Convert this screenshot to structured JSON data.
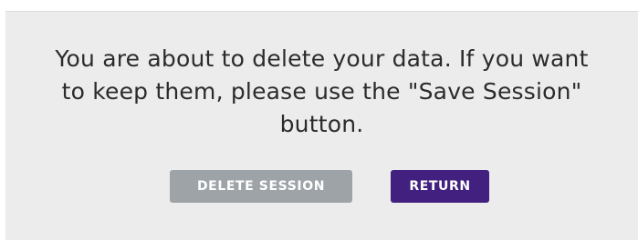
{
  "dialog": {
    "message": "You are about to delete your data. If you want to keep them, please use the \"Save Session\" button.",
    "buttons": {
      "delete_label": "DELETE SESSION",
      "return_label": "RETURN"
    }
  },
  "colors": {
    "dialog_background": "#ececec",
    "delete_button": "#9ea3a8",
    "return_button": "#41207f",
    "text": "#2b2b2b"
  }
}
